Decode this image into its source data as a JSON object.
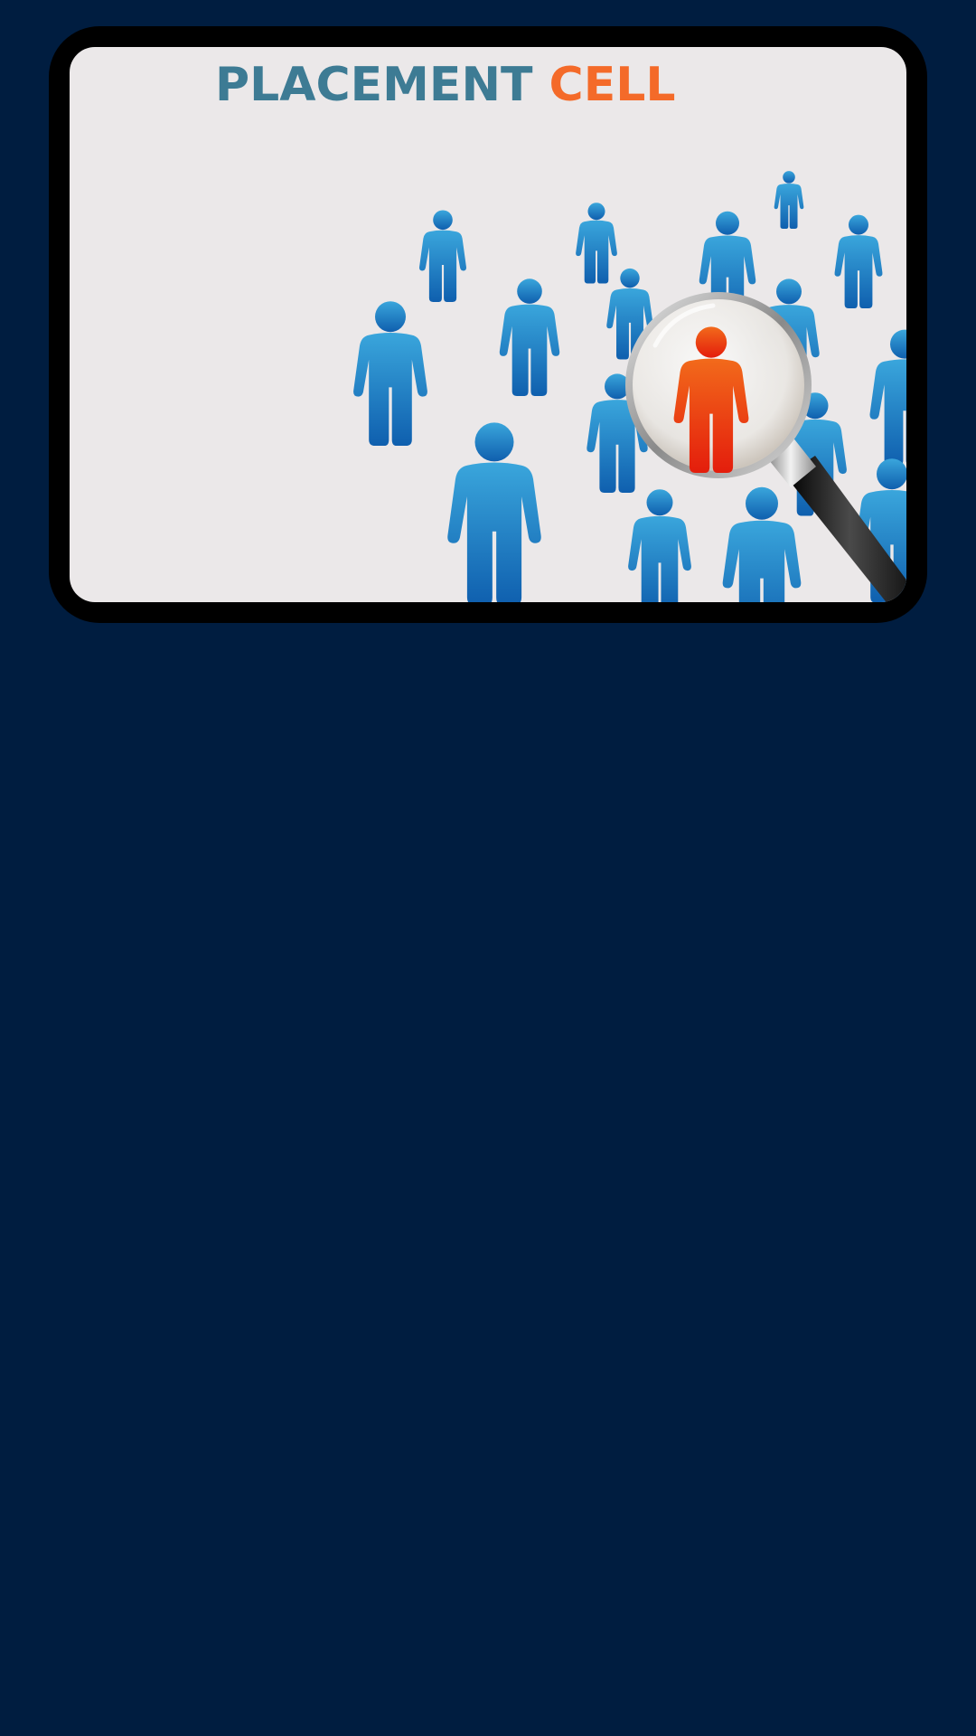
{
  "banner": {
    "title_part_1": "PLACEMENT ",
    "title_part_2": "CELL",
    "colors": {
      "page_background": "#001d40",
      "frame": "#000000",
      "card_background": "#ebe8e9",
      "title_part_1": "#3d7b94",
      "title_part_2": "#f46a29",
      "figure_light": "#3aa6dc",
      "figure_dark": "#0f5fae",
      "highlighted_figure_light": "#f26a1b",
      "highlighted_figure_dark": "#e41d0c"
    },
    "illustration": {
      "icons": [
        "person-icon",
        "highlighted-person-icon",
        "magnifying-glass-icon"
      ]
    }
  }
}
